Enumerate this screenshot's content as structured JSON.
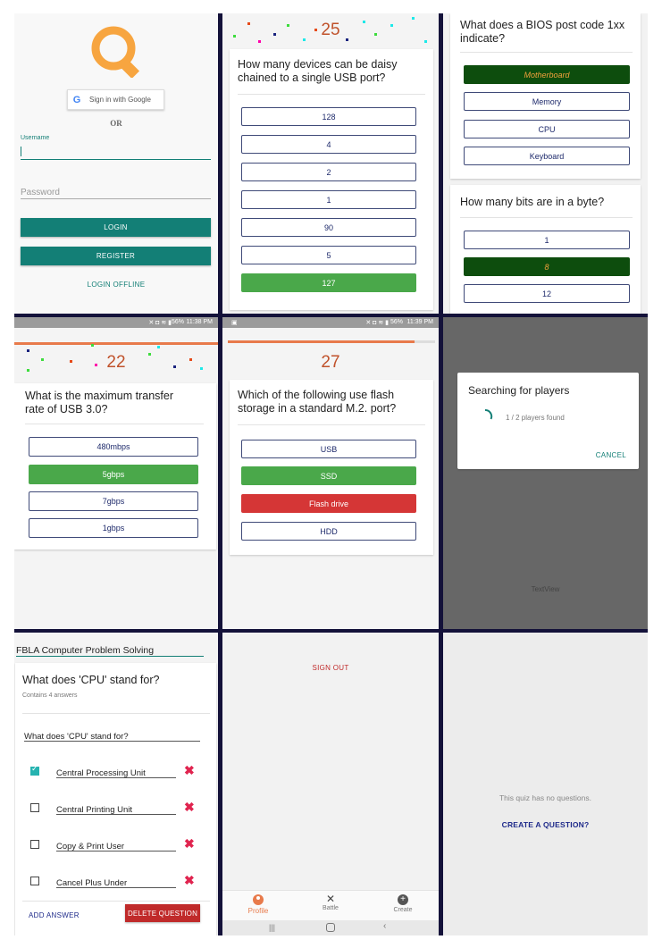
{
  "login": {
    "google_label": "Sign in with Google",
    "or_label": "OR",
    "username_label": "Username",
    "password_placeholder": "Password",
    "login_label": "LOGIN",
    "register_label": "REGISTER",
    "offline_label": "LOGIN OFFLINE"
  },
  "quiz25": {
    "score": "25",
    "question": "How many devices can be daisy chained to a single USB port?",
    "options": [
      "128",
      "4",
      "2",
      "1",
      "90",
      "5",
      "127"
    ],
    "correct_index": 6
  },
  "bios": {
    "q1": "What does a BIOS post code 1xx indicate?",
    "q1_options": [
      "Motherboard",
      "Memory",
      "CPU",
      "Keyboard"
    ],
    "q2": "How many bits are in a byte?",
    "q2_options": [
      "1",
      "8",
      "12"
    ]
  },
  "quiz22": {
    "status_time": "11:38 PM",
    "battery": "56%",
    "score": "22",
    "question": "What is the maximum transfer rate of USB 3.0?",
    "options": [
      "480mbps",
      "5gbps",
      "7gbps",
      "1gbps"
    ],
    "correct_index": 1
  },
  "quiz27": {
    "status_time": "11:39 PM",
    "battery": "56%",
    "score": "27",
    "question": "Which of the following use flash storage in a standard M.2. port?",
    "options": [
      "USB",
      "SSD",
      "Flash drive",
      "HDD"
    ]
  },
  "searching": {
    "title": "Searching for players",
    "progress": "1 / 2 players found",
    "cancel": "CANCEL",
    "bg_text": "TextView"
  },
  "editor": {
    "quiz_title": "FBLA Computer Problem Solving",
    "question": "What does 'CPU' stand for?",
    "answer_count": "Contains 4 answers",
    "question_input": "What does 'CPU' stand for?",
    "answers": [
      {
        "text": "Central Processing Unit",
        "checked": true
      },
      {
        "text": "Central Printing Unit",
        "checked": false
      },
      {
        "text": "Copy & Print User",
        "checked": false
      },
      {
        "text": "Cancel Plus Under",
        "checked": false
      }
    ],
    "add_answer": "ADD ANSWER",
    "delete_question": "DELETE QUESTION"
  },
  "profile": {
    "sign_out": "SIGN OUT",
    "nav": [
      {
        "label": "Profile",
        "icon": "person-icon"
      },
      {
        "label": "Battle",
        "icon": "crossed-swords-icon"
      },
      {
        "label": "Create",
        "icon": "plus-circle-icon"
      }
    ]
  },
  "empty_quiz": {
    "message": "This quiz has no questions.",
    "create": "CREATE A QUESTION?"
  },
  "colors": {
    "teal": "#137f76",
    "correct_green": "#4aa84a",
    "wrong_red": "#d53636",
    "dark_green": "#0d4d0d",
    "score_orange": "#c0522b",
    "logo_orange": "#f7a540",
    "delete_red": "#c02a2a"
  }
}
